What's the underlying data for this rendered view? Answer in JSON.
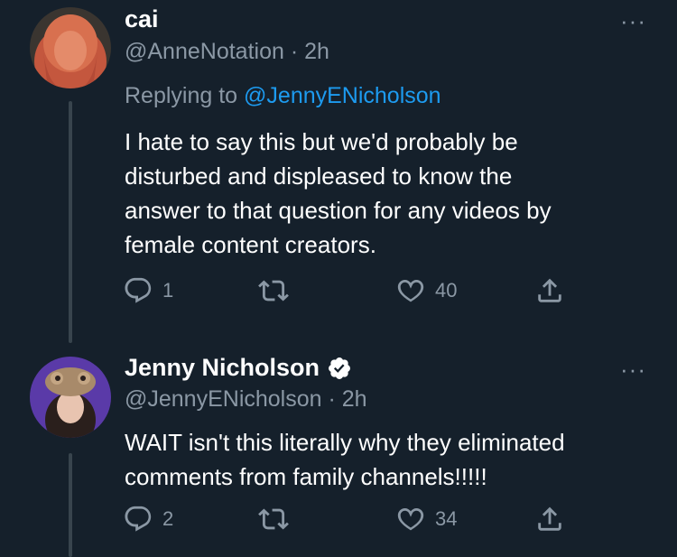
{
  "tweets": [
    {
      "name": "cai",
      "handle": "@AnneNotation",
      "time": "· 2h",
      "reply_prefix": "Replying to ",
      "reply_handle": "@JennyENicholson",
      "text": "I hate to say this but we'd probably be\ndisturbed and displeased to know the\nanswer to that question for any videos by\nfemale content creators.",
      "reply_count": "1",
      "retweet_count": "",
      "like_count": "40",
      "more": "···"
    },
    {
      "name": "Jenny Nicholson",
      "verified": true,
      "handle": "@JennyENicholson",
      "time": "· 2h",
      "text": "WAIT isn't this literally why they eliminated\ncomments from family channels!!!!!",
      "reply_count": "2",
      "retweet_count": "",
      "like_count": "34",
      "more": "···"
    }
  ],
  "colors": {
    "background": "#15202b",
    "secondary_text": "#8b98a5",
    "link": "#1d9bf0",
    "thread_line": "#38444d"
  },
  "icons": [
    "reply-icon",
    "retweet-icon",
    "like-icon",
    "share-icon",
    "verified-badge-icon",
    "more-icon"
  ]
}
